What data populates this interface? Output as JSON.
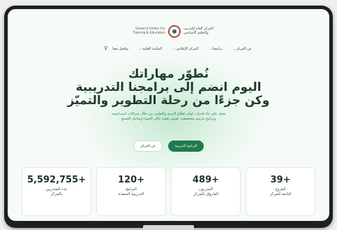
{
  "logo": {
    "en_line1": "General Center For",
    "en_line2": "Training & Education",
    "ar_line1": "المركز العام للتدريب",
    "ar_line2": "والتعليم الأساسي"
  },
  "nav": {
    "items": [
      {
        "label": "عن المركز"
      },
      {
        "label": "برامجنا"
      },
      {
        "label": "المركز الإعلامي"
      },
      {
        "label": "المكتبة العامة"
      },
      {
        "label": "تواصل معنا"
      }
    ]
  },
  "hero": {
    "line1": "نُطوّر مهاراتك",
    "line2": "اليوم انضم إلى برامجنا التدريبية",
    "line3": "وكن جزءًا من رحلة التطوير والتميّز",
    "sub1": "نعمل على بناء قدرات كوادر قطاع التربية والتعليم، من خلال شراكات استراتيجية",
    "sub2": "وبرامج تدريبية متخصصة، تضمن تعليم عالي الجودة وشامل للجميع"
  },
  "buttons": {
    "primary": "البرامج التدريبية",
    "secondary": "عن المركز"
  },
  "stats": [
    {
      "value": "39+",
      "label1": "الفروع",
      "label2": "التابعة للمركز"
    },
    {
      "value": "489+",
      "label1": "المدربون",
      "label2": "الفاروق بالمركز"
    },
    {
      "value": "120+",
      "label1": "البرامج",
      "label2": "التدريبية المنفذة"
    },
    {
      "value": "5,592,755+",
      "label1": "عدد المتدربين",
      "label2": "بالمركز"
    }
  ],
  "colors": {
    "primary": "#1f7a4d",
    "heading": "#1f3b2c",
    "subtext": "#2e7a4f"
  }
}
